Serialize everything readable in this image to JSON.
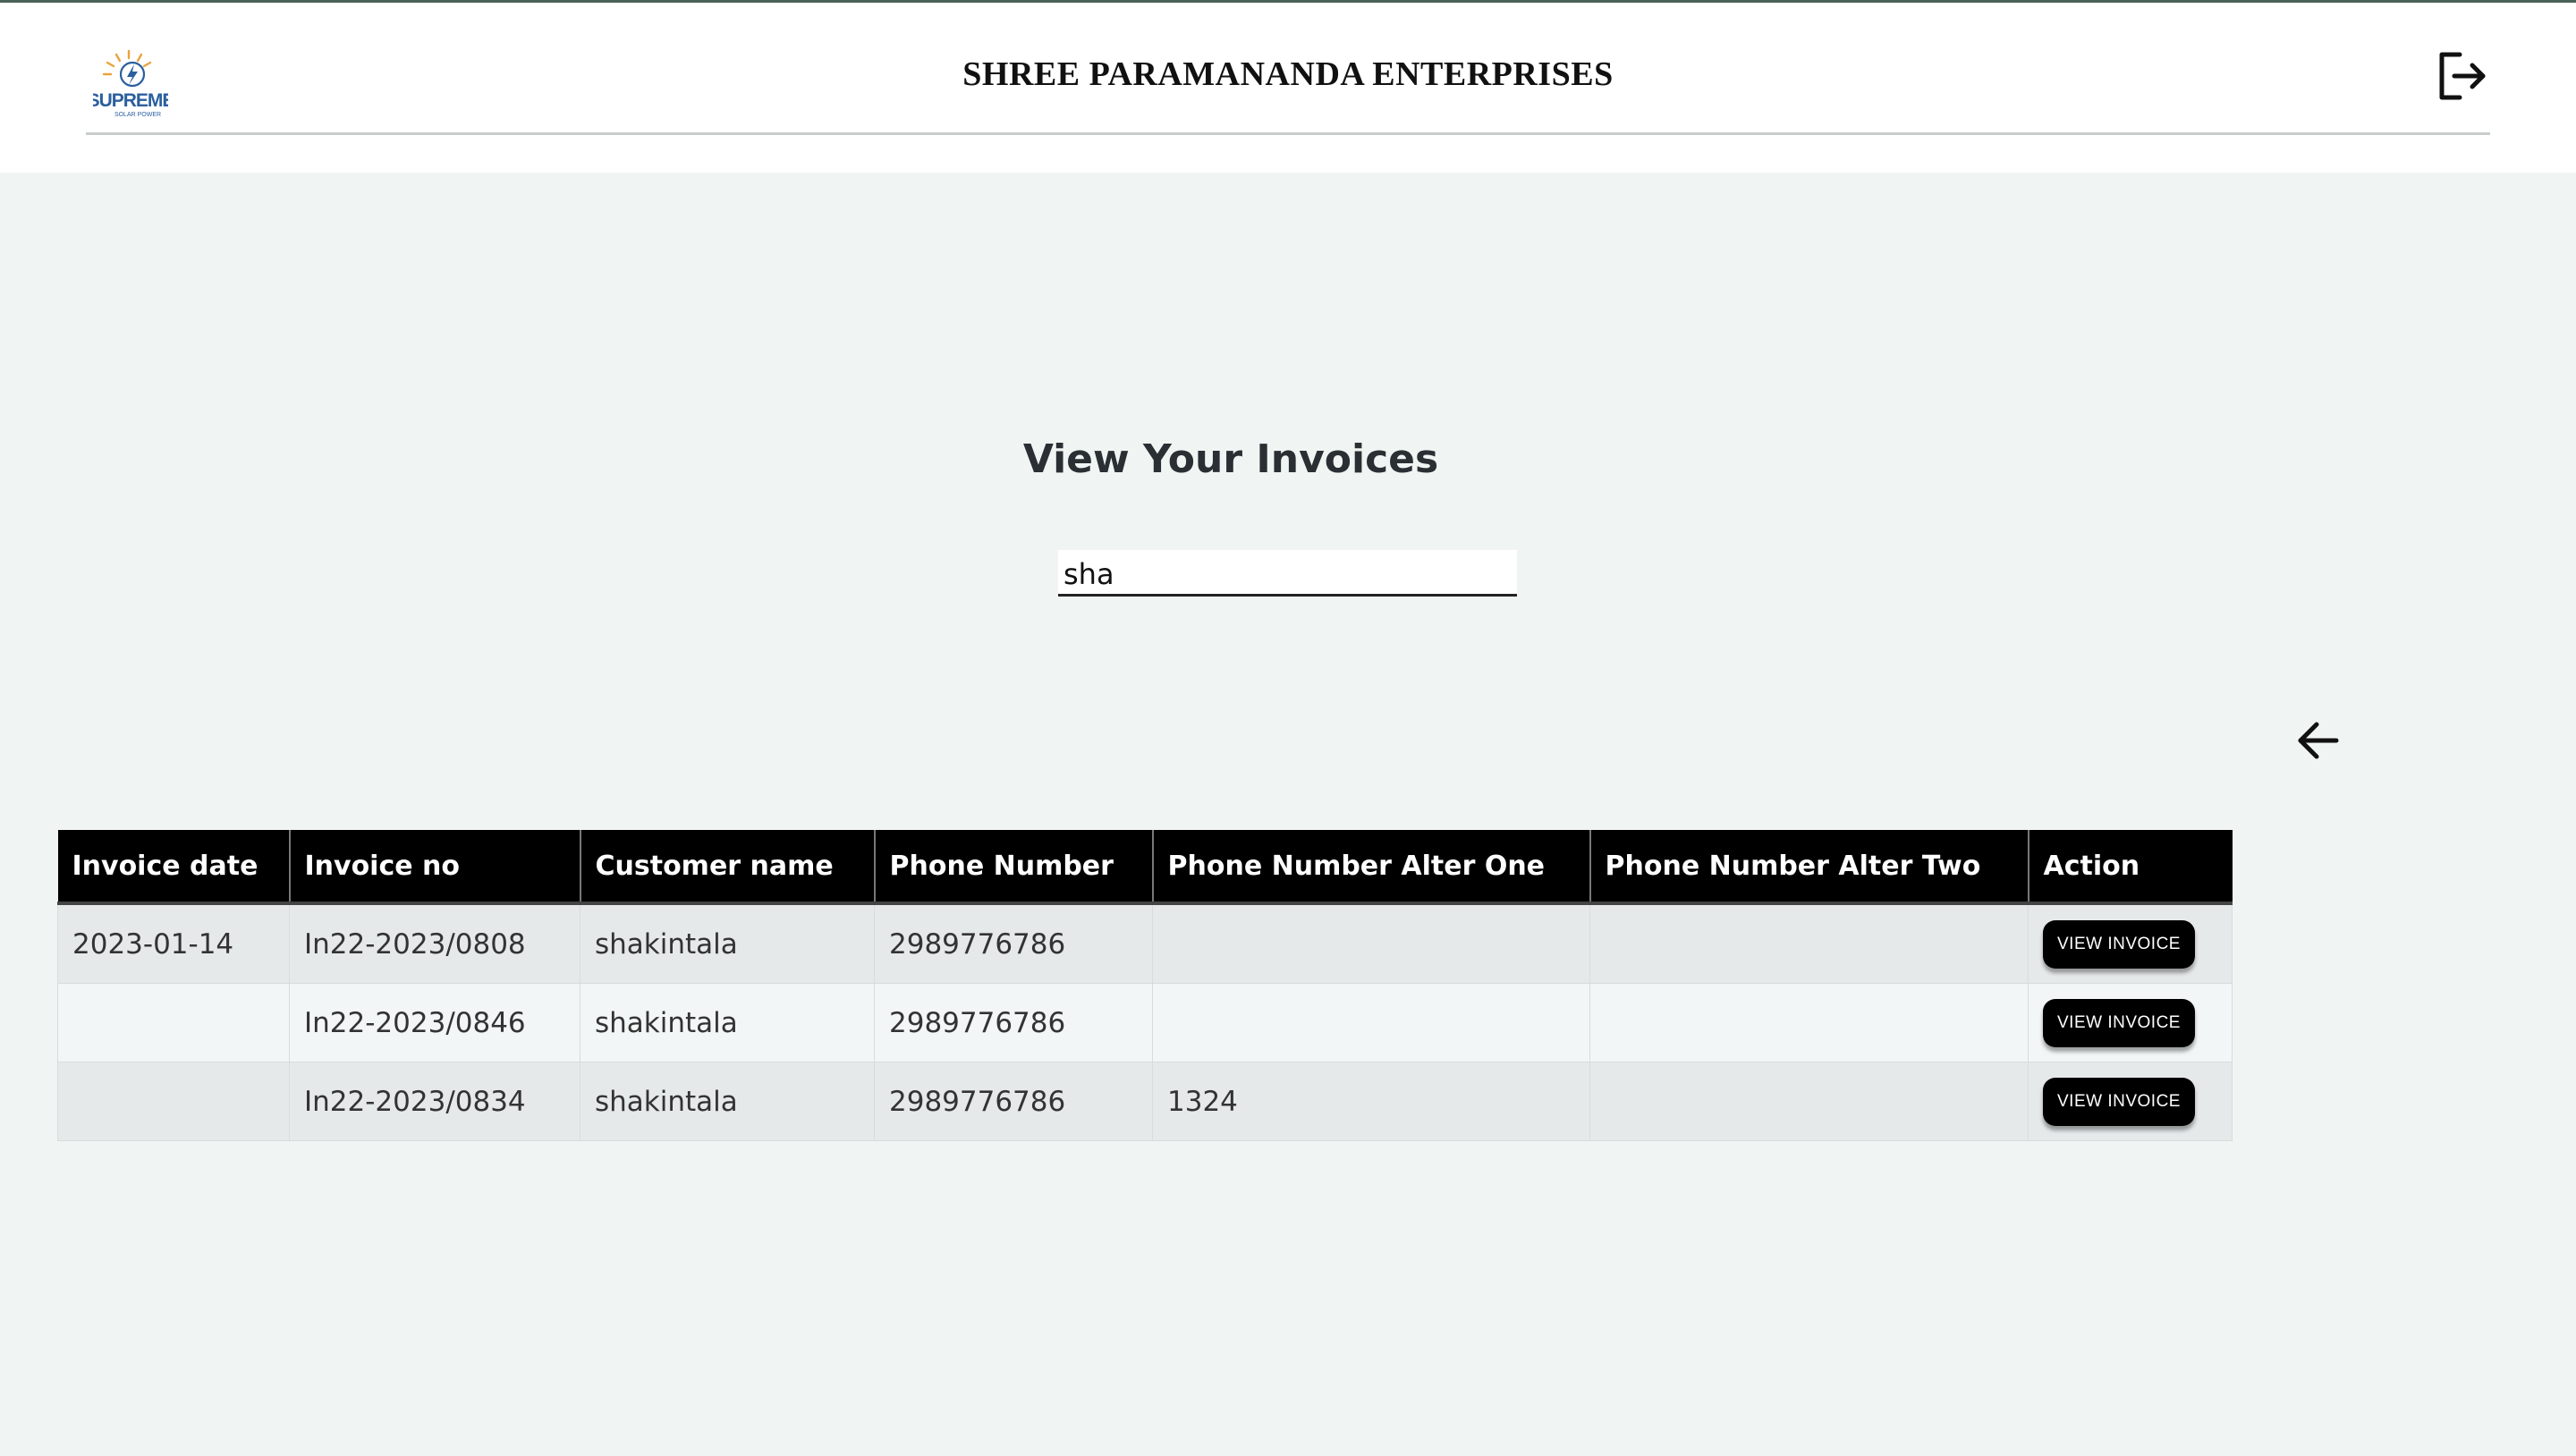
{
  "header": {
    "company_name": "SHREE PARAMANANDA ENTERPRISES",
    "logo_text": "SUPREME",
    "logo_subtext": "SOLAR POWER",
    "logout_icon": "logout-icon"
  },
  "main": {
    "heading": "View Your Invoices",
    "search": {
      "value": "sha",
      "placeholder": ""
    },
    "back_icon": "arrow-left-icon"
  },
  "table": {
    "headers": [
      "Invoice date",
      "Invoice no",
      "Customer name",
      "Phone Number",
      "Phone Number Alter One",
      "Phone Number Alter Two",
      "Action"
    ],
    "rows": [
      {
        "date": "2023-01-14",
        "invoice_no": "In22-2023/0808",
        "customer": "shakintala",
        "phone": "2989776786",
        "phone_alt1": "",
        "phone_alt2": "",
        "action": "VIEW INVOICE"
      },
      {
        "date": "",
        "invoice_no": "In22-2023/0846",
        "customer": "shakintala",
        "phone": "2989776786",
        "phone_alt1": "",
        "phone_alt2": "",
        "action": "VIEW INVOICE"
      },
      {
        "date": "",
        "invoice_no": "In22-2023/0834",
        "customer": "shakintala",
        "phone": "2989776786",
        "phone_alt1": "1324",
        "phone_alt2": "",
        "action": "VIEW INVOICE"
      }
    ]
  },
  "colors": {
    "page_background": "#f0f5f4",
    "header_background": "#ffffff",
    "table_header": "#000000",
    "button": "#000000",
    "logo_blue": "#2b5f9e",
    "logo_orange": "#e8a33d"
  }
}
